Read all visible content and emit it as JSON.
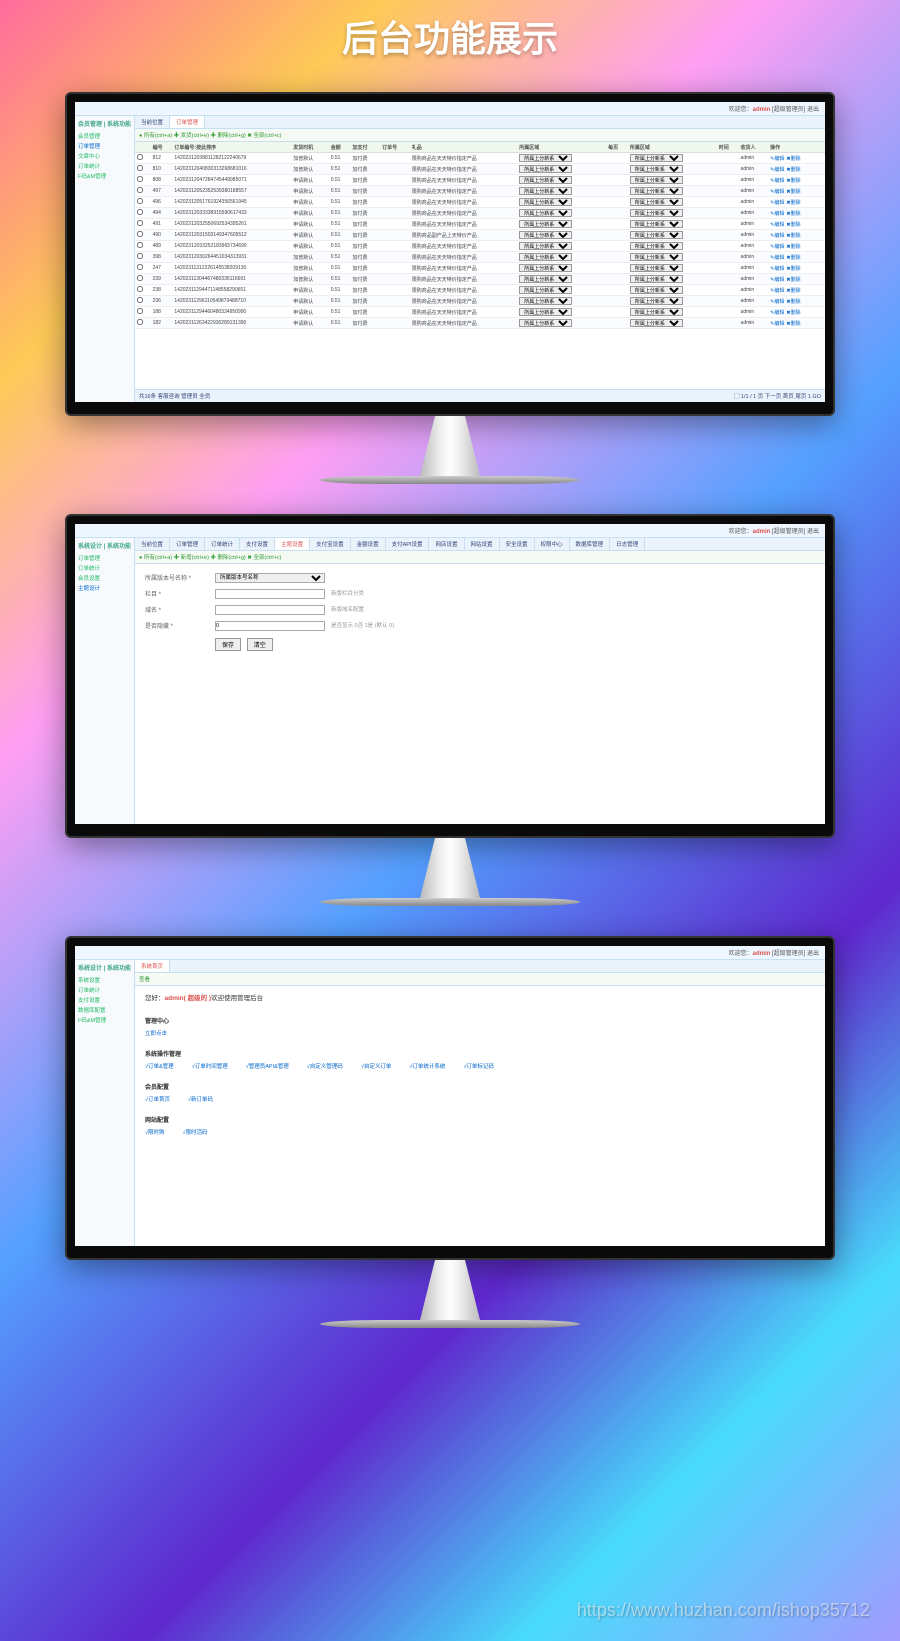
{
  "page": {
    "title": "后台功能展示"
  },
  "watermark": "https://www.huzhan.com/ishop35712",
  "header": {
    "welcome_prefix": "欢迎您：",
    "user": "admin",
    "role": "[超级管理员]",
    "logout": "退出"
  },
  "screen1": {
    "sidebar": {
      "title": "会员管理 | 系统功能",
      "items": [
        "会员管理",
        "订单管理",
        "文章中心",
        "订单统计",
        "F码&M管理"
      ]
    },
    "tabs": [
      "当前位置",
      "订单管理"
    ],
    "toolbar": "● 所有(ctrl+a)  ✚ 发货(ctrl+e)  ✚ 删除(ctrl+g)  ✖ 全部(ctrl+c)",
    "columns": [
      "",
      "编号",
      "订单编号:按此排序",
      "发货时机",
      "金额",
      "加支付",
      "订单号",
      "礼品",
      "所属区域",
      "每页",
      "所属区域",
      "时间",
      "收货人",
      "操作"
    ],
    "rows": [
      {
        "id": "812",
        "no": "14202312038811282122240679",
        "tm": "加普默认",
        "amt": "0.51",
        "pay": "加付费",
        "gift": "限购商品在天天特价指定产品",
        "area": "所属上分新系",
        "phone": "admin",
        "op": "✎编辑 ✖删除"
      },
      {
        "id": "810",
        "no": "14202312040830313268681016",
        "tm": "加普默认",
        "amt": "0.51",
        "pay": "加付费",
        "gift": "限购商品在天天特价指定产品",
        "area": "所属上分新系",
        "phone": "admin",
        "op": "✎编辑 ✖删除"
      },
      {
        "id": "808",
        "no": "14202312047284745449985071",
        "tm": "申请默认",
        "amt": "0.51",
        "pay": "加付费",
        "gift": "限购商品在天天特价指定产品",
        "area": "所属上分新系",
        "phone": "admin",
        "op": "✎编辑 ✖删除"
      },
      {
        "id": "497",
        "no": "14202312052352539380188557",
        "tm": "申请默认",
        "amt": "0.51",
        "pay": "加付费",
        "gift": "限购商品在天天特价指定产品",
        "area": "所属上分新系",
        "phone": "admin",
        "op": "✎编辑 ✖删除"
      },
      {
        "id": "496",
        "no": "14202312051761924356561945",
        "tm": "申请默认",
        "amt": "0.51",
        "pay": "加付费",
        "gift": "限购商品在天天特价指定产品",
        "area": "所属上分新系",
        "phone": "admin",
        "op": "✎编辑 ✖删除"
      },
      {
        "id": "494",
        "no": "14202312033338915590617433",
        "tm": "申请默认",
        "amt": "0.51",
        "pay": "加付费",
        "gift": "限购商品在天天特价指定产品",
        "area": "所属上分新系",
        "phone": "admin",
        "op": "✎编辑 ✖删除"
      },
      {
        "id": "491",
        "no": "14202312032550692534395261",
        "tm": "申请默认",
        "amt": "0.51",
        "pay": "加付费",
        "gift": "限购商品在天天特价指定产品",
        "area": "所属上分新系",
        "phone": "admin",
        "op": "✎编辑 ✖删除"
      },
      {
        "id": "490",
        "no": "14202312031503149347605512",
        "tm": "申请默认",
        "amt": "0.51",
        "pay": "加付费",
        "gift": "限购商品副产品上天特价产品",
        "area": "所属上分新系",
        "phone": "admin",
        "op": "✎编辑 ✖删除"
      },
      {
        "id": "489",
        "no": "14202312033252183965734699",
        "tm": "申请默认",
        "amt": "0.51",
        "pay": "加付费",
        "gift": "限购商品在天天特价指定产品",
        "area": "所属上分新系",
        "phone": "admin",
        "op": "✎编辑 ✖删除"
      },
      {
        "id": "398",
        "no": "14202312030264451034313931",
        "tm": "加普默认",
        "amt": "0.51",
        "pay": "加付费",
        "gift": "限购商品在天天特价指定产品",
        "area": "所属上分新系",
        "phone": "admin",
        "op": "✎编辑 ✖删除"
      },
      {
        "id": "247",
        "no": "14202311312226145538209130",
        "tm": "加普默认",
        "amt": "0.51",
        "pay": "加付费",
        "gift": "限购商品在天天特价指定产品",
        "area": "所属上分新系",
        "phone": "admin",
        "op": "✎编辑 ✖删除"
      },
      {
        "id": "239",
        "no": "14202311304467480336116691",
        "tm": "加普默认",
        "amt": "0.51",
        "pay": "加付费",
        "gift": "限购商品在天天特价指定产品",
        "area": "所属上分新系",
        "phone": "admin",
        "op": "✎编辑 ✖删除"
      },
      {
        "id": "238",
        "no": "14202311294471148558290651",
        "tm": "申请默认",
        "amt": "0.51",
        "pay": "加付费",
        "gift": "限购商品在天天特价指定产品",
        "area": "所属上分新系",
        "phone": "admin",
        "op": "✎编辑 ✖删除"
      },
      {
        "id": "236",
        "no": "14202311296110549873488710",
        "tm": "申请默认",
        "amt": "0.51",
        "pay": "加付费",
        "gift": "限购商品在天天特价指定产品",
        "area": "所属上分新系",
        "phone": "admin",
        "op": "✎编辑 ✖删除"
      },
      {
        "id": "188",
        "no": "14202311294460480334950990",
        "tm": "申请默认",
        "amt": "0.51",
        "pay": "加付费",
        "gift": "限购商品在天天特价指定产品",
        "area": "所属上分新系",
        "phone": "admin",
        "op": "✎编辑 ✖删除"
      },
      {
        "id": "182",
        "no": "14202311263422930289131390",
        "tm": "申请默认",
        "amt": "0.51",
        "pay": "加付费",
        "gift": "限购商品在天天特价指定产品",
        "area": "所属上分新系",
        "phone": "admin",
        "op": "✎编辑 ✖删除"
      }
    ],
    "pager_left": "共16条  客服咨询  管理员  全员",
    "pager_right": "▢ 1/1 / 1 页 下一页 首页 尾页 1 GO"
  },
  "screen2": {
    "sidebar": {
      "title": "系统设计 | 系统功能",
      "items": [
        "订单管理",
        "订单统计",
        "会员设置",
        "主题设计"
      ]
    },
    "tabs": [
      "当前位置",
      "订单管理",
      "订单统计",
      "支付设置",
      "主题设置",
      "支付宝设置",
      "金额设置",
      "支付API设置",
      "网店设置",
      "网站设置",
      "安全设置",
      "权限中心",
      "数据库管理",
      "日志管理"
    ],
    "active_tab": "主题设置",
    "toolbar": "● 所有(ctrl+a)  ✚ 新增(ctrl+e)  ✚ 删除(ctrl+g)  ✖ 全部(ctrl+c)",
    "form": [
      {
        "label": "所属版本号名称 *",
        "type": "select",
        "value": "所属版本号名称",
        "hint": ""
      },
      {
        "label": "栏目 *",
        "type": "text",
        "value": "",
        "hint": "新版栏目分类"
      },
      {
        "label": "域名 *",
        "type": "text",
        "value": "",
        "hint": "新版域名配置"
      },
      {
        "label": "是否隐藏 *",
        "type": "text",
        "value": "0",
        "hint": "是否显示 0否 1是 (默认 0)"
      }
    ],
    "buttons": [
      "保存",
      "清空"
    ]
  },
  "screen3": {
    "sidebar": {
      "title": "系统设计 | 系统功能",
      "items": [
        "系统设置",
        "订单统计",
        "支付设置",
        "数据库配置",
        "F码&M管理"
      ]
    },
    "tabs": [
      "系统首页"
    ],
    "toolbar": "查看",
    "welcome": {
      "prefix": "您好：",
      "user": "admin( 超级的 )",
      "suffix": "欢迎使用管理后台"
    },
    "sections": [
      {
        "title": "管理中心",
        "links": [
          "立即点击"
        ]
      },
      {
        "title": "系统操作管理",
        "links": [
          "√订单&管理",
          "√订单时间管理",
          "√管理员API&管理",
          "√自定义管理码",
          "√自定义订单",
          "√订单统计系统",
          "√订单标记码"
        ]
      },
      {
        "title": "会员配置",
        "links": [
          "√订单首页",
          "√新订单码"
        ]
      },
      {
        "title": "网站配置",
        "links": [
          "√限时购",
          "√限时活码"
        ]
      }
    ]
  }
}
